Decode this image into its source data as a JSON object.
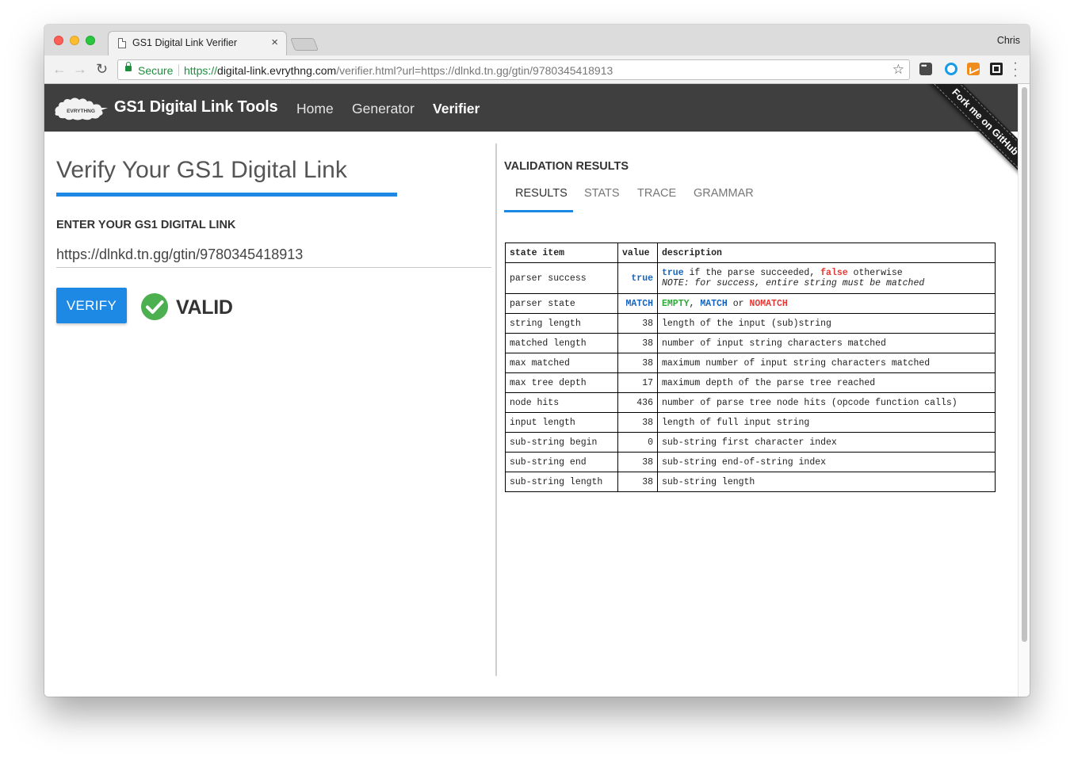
{
  "browser": {
    "tab_title": "GS1 Digital Link Verifier",
    "tab_close": "×",
    "profile_name": "Chris",
    "secure_label": "Secure",
    "url_scheme": "https://",
    "url_host": "digital-link.evrythng.com",
    "url_path": "/verifier.html?url=https://dlnkd.tn.gg/gtin/9780345418913"
  },
  "navbar": {
    "brand": "GS1 Digital Link Tools",
    "logo_text": "EVRYTHNG",
    "links": [
      "Home",
      "Generator",
      "Verifier"
    ],
    "active_link": "Verifier",
    "ribbon": "Fork me on GitHub"
  },
  "verify": {
    "title": "Verify Your GS1 Digital Link",
    "input_label": "ENTER YOUR GS1 DIGITAL LINK",
    "input_value": "https://dlnkd.tn.gg/gtin/9780345418913",
    "button_label": "VERIFY",
    "result_text": "VALID"
  },
  "validation": {
    "title": "VALIDATION RESULTS",
    "tabs": [
      "RESULTS",
      "STATS",
      "TRACE",
      "GRAMMAR"
    ],
    "active_tab": "RESULTS",
    "table": {
      "headers": [
        "state item",
        "value",
        "description"
      ],
      "parser_success": {
        "item": "parser success",
        "value": "true",
        "desc_kw_true": "true",
        "desc_mid": " if the parse succeeded, ",
        "desc_kw_false": "false",
        "desc_end": " otherwise",
        "desc_note": "NOTE: for success, entire string must be matched"
      },
      "parser_state": {
        "item": "parser state",
        "value": "MATCH",
        "kw_empty": "EMPTY",
        "sep1": ", ",
        "kw_match": "MATCH",
        "sep2": " or ",
        "kw_nomatch": "NOMATCH"
      },
      "rows": [
        {
          "item": "string length",
          "value": "38",
          "description": "length of the input (sub)string"
        },
        {
          "item": "matched length",
          "value": "38",
          "description": "number of input string characters matched"
        },
        {
          "item": "max matched",
          "value": "38",
          "description": "maximum number of input string characters matched"
        },
        {
          "item": "max tree depth",
          "value": "17",
          "description": "maximum depth of the parse tree reached"
        },
        {
          "item": "node hits",
          "value": "436",
          "description": "number of parse tree node hits (opcode function calls)"
        },
        {
          "item": "input length",
          "value": "38",
          "description": "length of full input string"
        },
        {
          "item": "sub-string begin",
          "value": "0",
          "description": "sub-string first character index"
        },
        {
          "item": "sub-string end",
          "value": "38",
          "description": "sub-string end-of-string index"
        },
        {
          "item": "sub-string length",
          "value": "38",
          "description": "sub-string length"
        }
      ]
    }
  },
  "colors": {
    "accent": "#1e88e5",
    "navbar_bg": "#3f3f3f",
    "valid_green": "#4caf50",
    "true_blue": "#1565c0",
    "false_red": "#e53935",
    "empty_green": "#2eaa3a"
  }
}
